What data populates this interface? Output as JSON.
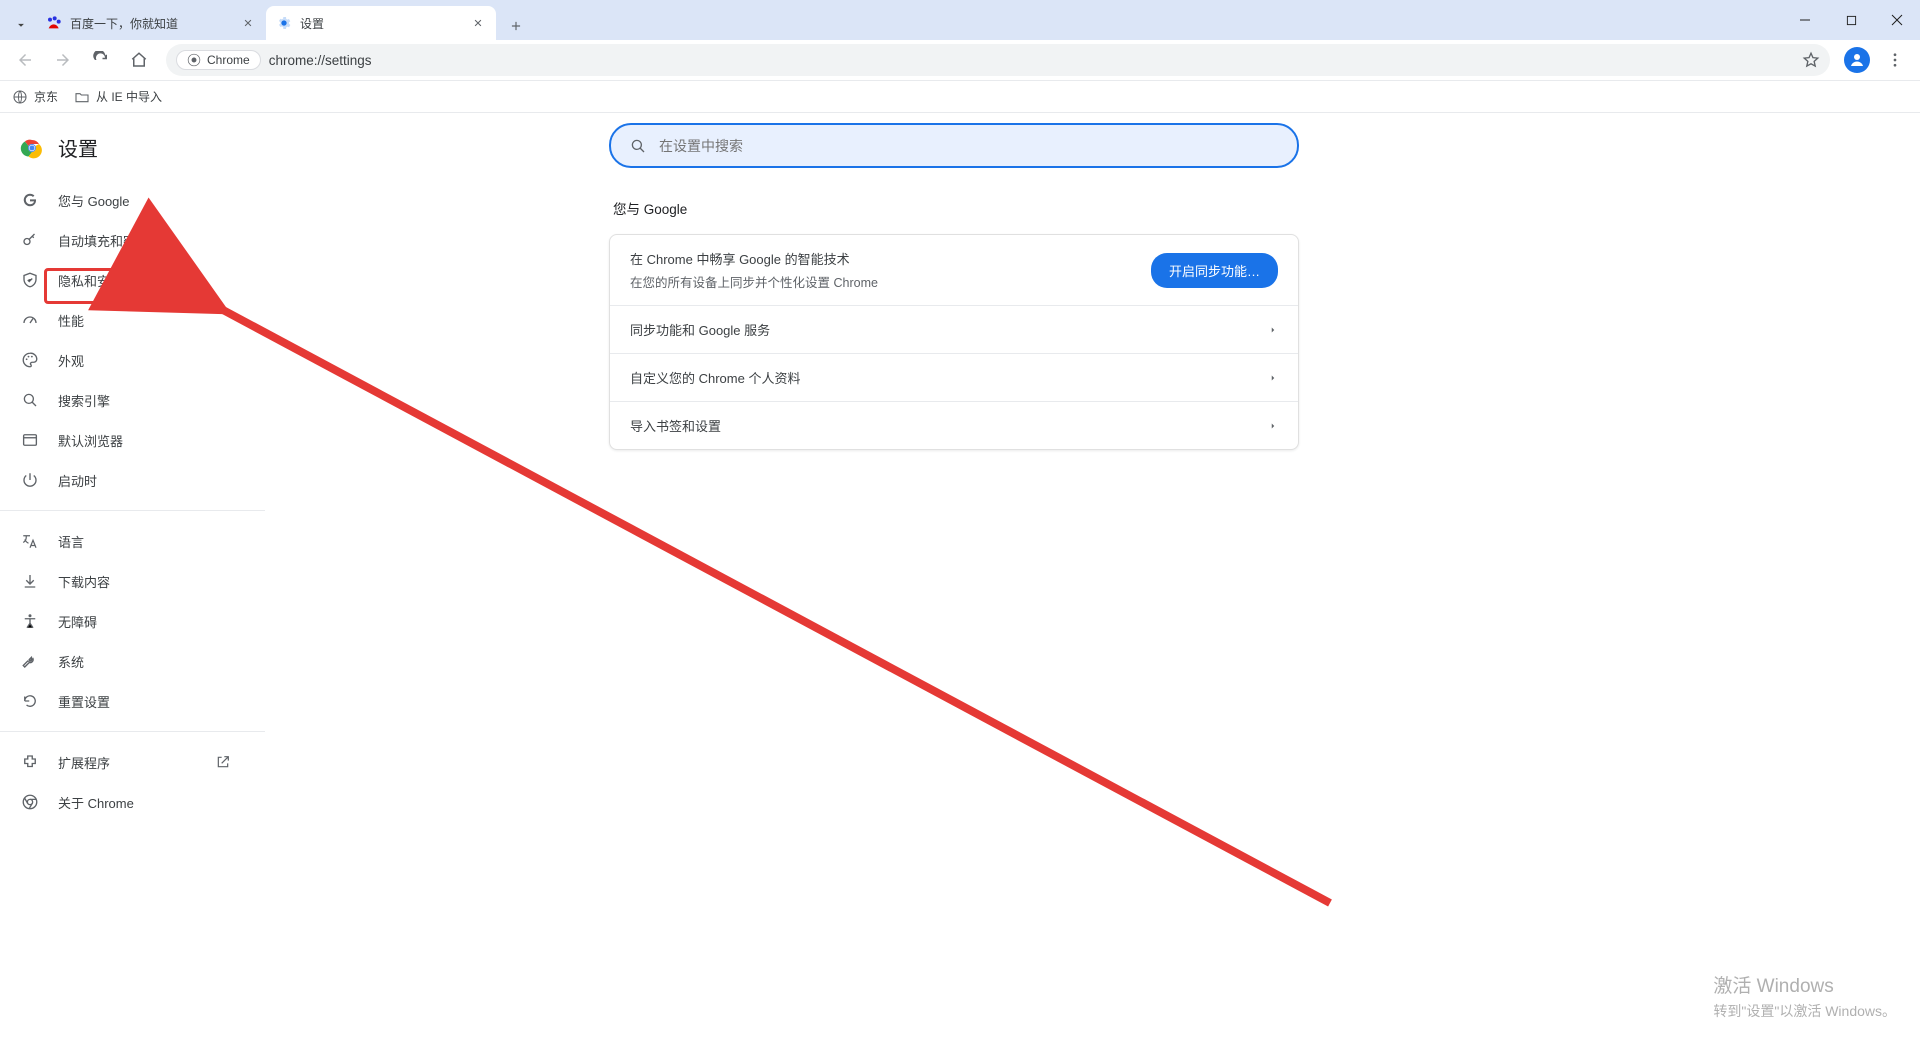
{
  "tabs": [
    {
      "title": "百度一下，你就知道",
      "active": false
    },
    {
      "title": "设置",
      "active": true
    }
  ],
  "omnibox": {
    "chip_label": "Chrome",
    "url": "chrome://settings"
  },
  "bookmarks": [
    {
      "label": "京东"
    },
    {
      "label": "从 IE 中导入"
    }
  ],
  "sidebar": {
    "header": "设置",
    "items_a": [
      {
        "label": "您与 Google",
        "icon": "google"
      },
      {
        "label": "自动填充和密码",
        "icon": "key"
      },
      {
        "label": "隐私和安全",
        "icon": "shield",
        "highlighted": true
      },
      {
        "label": "性能",
        "icon": "gauge"
      },
      {
        "label": "外观",
        "icon": "palette"
      },
      {
        "label": "搜索引擎",
        "icon": "search"
      },
      {
        "label": "默认浏览器",
        "icon": "window"
      },
      {
        "label": "启动时",
        "icon": "power"
      }
    ],
    "items_b": [
      {
        "label": "语言",
        "icon": "translate"
      },
      {
        "label": "下载内容",
        "icon": "download"
      },
      {
        "label": "无障碍",
        "icon": "accessibility"
      },
      {
        "label": "系统",
        "icon": "wrench"
      },
      {
        "label": "重置设置",
        "icon": "reset"
      }
    ],
    "items_c": [
      {
        "label": "扩展程序",
        "icon": "extension",
        "external": true
      },
      {
        "label": "关于 Chrome",
        "icon": "chrome"
      }
    ]
  },
  "search": {
    "placeholder": "在设置中搜索"
  },
  "section": {
    "title": "您与 Google"
  },
  "card": {
    "sync_title": "在 Chrome 中畅享 Google 的智能技术",
    "sync_sub": "在您的所有设备上同步并个性化设置 Chrome",
    "sync_btn": "开启同步功能…",
    "rows": [
      "同步功能和 Google 服务",
      "自定义您的 Chrome 个人资料",
      "导入书签和设置"
    ]
  },
  "watermark": {
    "line1": "激活 Windows",
    "line2": "转到\"设置\"以激活 Windows。"
  }
}
